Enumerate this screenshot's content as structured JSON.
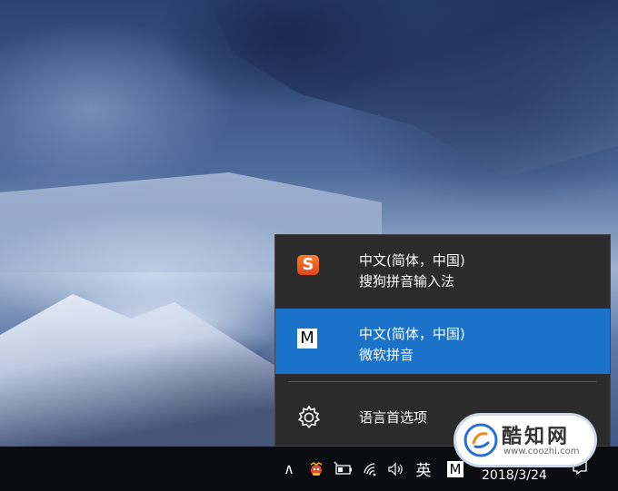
{
  "flyout": {
    "items": [
      {
        "line1": "中文(简体，中国)",
        "line2": "搜狗拼音输入法",
        "icon": "sogou-icon",
        "selected": false,
        "icon_glyph": "S"
      },
      {
        "line1": "中文(简体，中国)",
        "line2": "微软拼音",
        "icon": "microsoft-pinyin-icon",
        "selected": true,
        "icon_glyph": "M"
      }
    ],
    "preferences_label": "语言首选项",
    "preferences_icon": "gear-icon"
  },
  "taskbar": {
    "chevron": "∧",
    "language_indicator": "英",
    "ime_indicator": "M",
    "date": "2018/3/24",
    "tray_icons": [
      "show-hidden-icons-chevron",
      "app-tray-icon",
      "battery-icon",
      "wifi-icon",
      "volume-icon"
    ]
  },
  "watermark": {
    "name": "酷知网",
    "url": "www.coozhi.com"
  },
  "colors": {
    "flyout_bg": "#2b2b2b",
    "selected_bg": "#1a73c9",
    "taskbar_bg": "#0b0c10",
    "sogou_orange": "#e0471a"
  }
}
